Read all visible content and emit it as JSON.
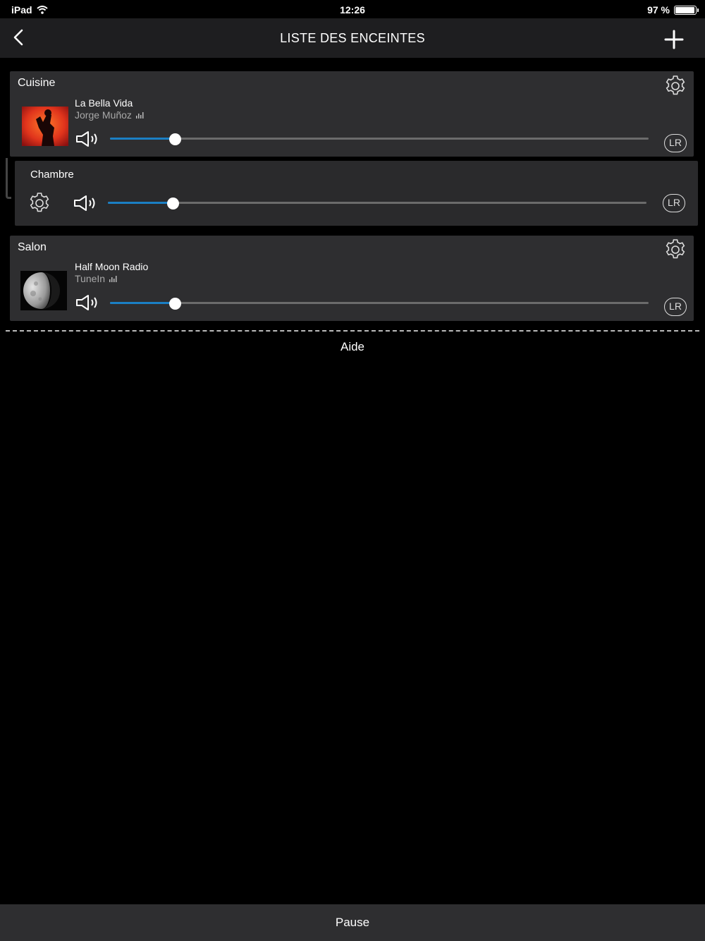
{
  "status_bar": {
    "device": "iPad",
    "time": "12:26",
    "battery": "97 %",
    "battery_level": 0.97
  },
  "nav": {
    "title": "LISTE DES ENCEINTES"
  },
  "speakers": [
    {
      "name": "Cuisine",
      "track_title": "La Bella Vida",
      "track_subtitle": "Jorge Muñoz",
      "volume": 0.12,
      "channel": "LR"
    },
    {
      "name": "Chambre",
      "volume": 0.12,
      "channel": "LR"
    },
    {
      "name": "Salon",
      "track_title": "Half Moon Radio",
      "track_subtitle": "TuneIn",
      "volume": 0.12,
      "channel": "LR"
    }
  ],
  "help_label": "Aide",
  "bottom_bar": {
    "label": "Pause"
  },
  "colors": {
    "background": "#000000",
    "card": "#2e2e30",
    "accent": "#1b7fc4"
  }
}
